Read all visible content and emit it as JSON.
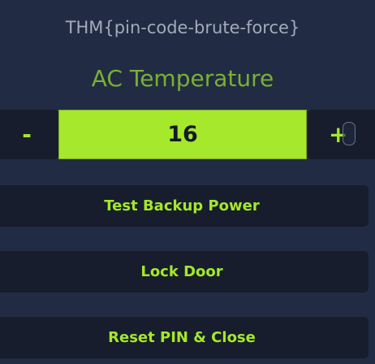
{
  "flag_text": "THM{pin-code-brute-force}",
  "title": "AC Temperature",
  "temperature": {
    "value": "16",
    "decrement_label": "-",
    "increment_label": "+"
  },
  "actions": [
    {
      "label": "Test Backup Power"
    },
    {
      "label": "Lock Door"
    },
    {
      "label": "Reset PIN & Close"
    }
  ],
  "colors": {
    "background": "#222b44",
    "panel": "#171d2c",
    "accent": "#a5e82c",
    "title": "#79b032",
    "flag_text": "#a3abbb"
  }
}
